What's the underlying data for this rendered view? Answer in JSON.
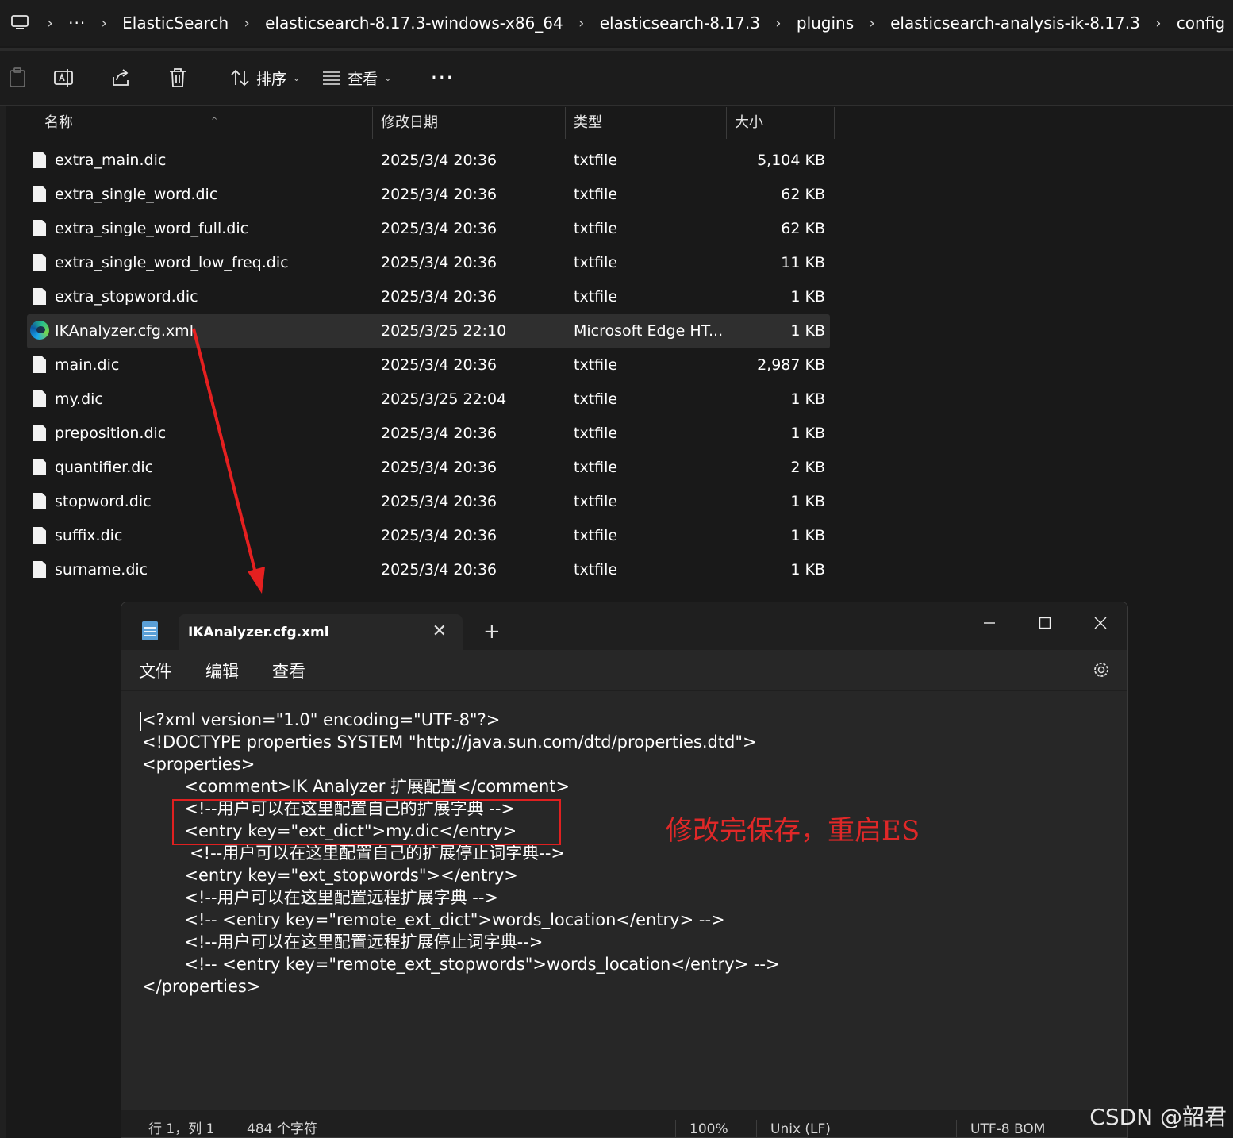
{
  "explorer": {
    "breadcrumb": {
      "overflow": "···",
      "items": [
        "ElasticSearch",
        "elasticsearch-8.17.3-windows-x86_64",
        "elasticsearch-8.17.3",
        "plugins",
        "elasticsearch-analysis-ik-8.17.3",
        "config"
      ]
    },
    "toolbar": {
      "sort_label": "排序",
      "view_label": "查看",
      "more_label": "···"
    },
    "columns": {
      "name": "名称",
      "modified": "修改日期",
      "type": "类型",
      "size": "大小"
    },
    "files": [
      {
        "name": "extra_main.dic",
        "date": "2025/3/4 20:36",
        "type": "txtfile",
        "size": "5,104 KB",
        "icon": "document-icon"
      },
      {
        "name": "extra_single_word.dic",
        "date": "2025/3/4 20:36",
        "type": "txtfile",
        "size": "62 KB",
        "icon": "document-icon"
      },
      {
        "name": "extra_single_word_full.dic",
        "date": "2025/3/4 20:36",
        "type": "txtfile",
        "size": "62 KB",
        "icon": "document-icon"
      },
      {
        "name": "extra_single_word_low_freq.dic",
        "date": "2025/3/4 20:36",
        "type": "txtfile",
        "size": "11 KB",
        "icon": "document-icon"
      },
      {
        "name": "extra_stopword.dic",
        "date": "2025/3/4 20:36",
        "type": "txtfile",
        "size": "1 KB",
        "icon": "document-icon"
      },
      {
        "name": "IKAnalyzer.cfg.xml",
        "date": "2025/3/25 22:10",
        "type": "Microsoft Edge HT...",
        "size": "1 KB",
        "icon": "edge-icon",
        "selected": true
      },
      {
        "name": "main.dic",
        "date": "2025/3/4 20:36",
        "type": "txtfile",
        "size": "2,987 KB",
        "icon": "document-icon"
      },
      {
        "name": "my.dic",
        "date": "2025/3/25 22:04",
        "type": "txtfile",
        "size": "1 KB",
        "icon": "document-icon"
      },
      {
        "name": "preposition.dic",
        "date": "2025/3/4 20:36",
        "type": "txtfile",
        "size": "1 KB",
        "icon": "document-icon"
      },
      {
        "name": "quantifier.dic",
        "date": "2025/3/4 20:36",
        "type": "txtfile",
        "size": "2 KB",
        "icon": "document-icon"
      },
      {
        "name": "stopword.dic",
        "date": "2025/3/4 20:36",
        "type": "txtfile",
        "size": "1 KB",
        "icon": "document-icon"
      },
      {
        "name": "suffix.dic",
        "date": "2025/3/4 20:36",
        "type": "txtfile",
        "size": "1 KB",
        "icon": "document-icon"
      },
      {
        "name": "surname.dic",
        "date": "2025/3/4 20:36",
        "type": "txtfile",
        "size": "1 KB",
        "icon": "document-icon"
      }
    ]
  },
  "notepad": {
    "tab_title": "IKAnalyzer.cfg.xml",
    "menu": {
      "file": "文件",
      "edit": "编辑",
      "view": "查看"
    },
    "lines": [
      "<?xml version=\"1.0\" encoding=\"UTF-8\"?>",
      "<!DOCTYPE properties SYSTEM \"http://java.sun.com/dtd/properties.dtd\">",
      "<properties>",
      "        <comment>IK Analyzer 扩展配置</comment>",
      "        <!--用户可以在这里配置自己的扩展字典 -->",
      "        <entry key=\"ext_dict\">my.dic</entry>",
      "         <!--用户可以在这里配置自己的扩展停止词字典-->",
      "        <entry key=\"ext_stopwords\"></entry>",
      "        <!--用户可以在这里配置远程扩展字典 -->",
      "        <!-- <entry key=\"remote_ext_dict\">words_location</entry> -->",
      "        <!--用户可以在这里配置远程扩展停止词字典-->",
      "        <!-- <entry key=\"remote_ext_stopwords\">words_location</entry> -->",
      "</properties>"
    ],
    "status": {
      "position": "行 1，列 1",
      "chars": "484 个字符",
      "zoom": "100%",
      "line_ending": "Unix (LF)",
      "encoding": "UTF-8 BOM"
    }
  },
  "annotation": {
    "text": "修改完保存，重启ES",
    "color": "#e02020"
  },
  "watermark": "CSDN @韶君"
}
